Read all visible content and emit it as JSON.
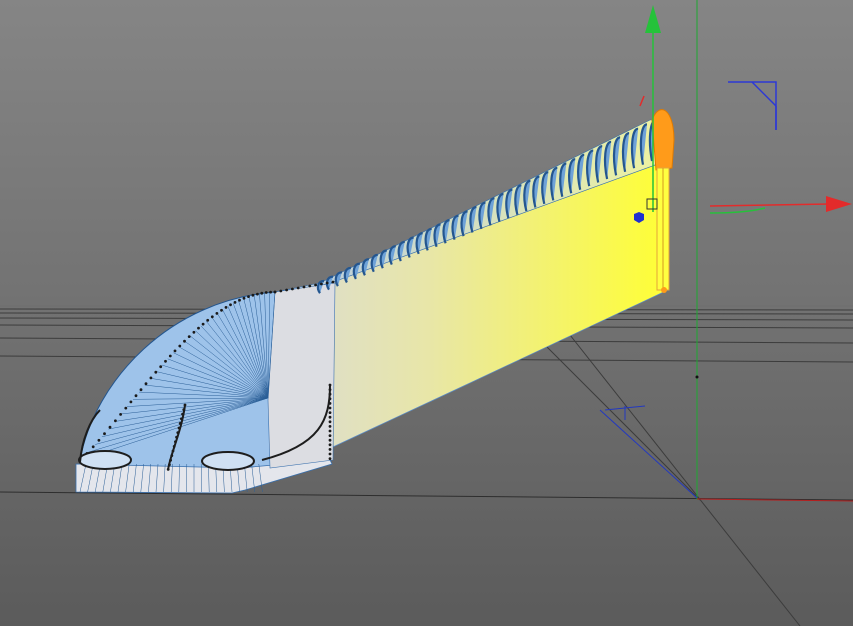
{
  "viewport": {
    "view": "perspective",
    "background_top": "#858585",
    "background_bottom": "#5b5b5b",
    "grid_color": "#3c3c3c",
    "horizon_color": "#6e6e6e"
  },
  "model": {
    "object": "train-nose-sweep",
    "mesh_color": "#6ea2d8",
    "wire_color": "#2b5f97",
    "point_color": "#1a1a1a",
    "side_gradient_start": "#d7d9e0",
    "side_gradient_end": "#ffff33",
    "end_cap_color": "#ff9b1a"
  },
  "gizmo": {
    "x_axis_color": "#e32b2b",
    "y_axis_color": "#25c23a",
    "z_axis_color": "#2c38d6",
    "axis_center_color": "#2030d0"
  },
  "world_axes": {
    "x_color": "#b51e1e",
    "y_color": "#1ea832",
    "z_color": "#2238c0"
  }
}
